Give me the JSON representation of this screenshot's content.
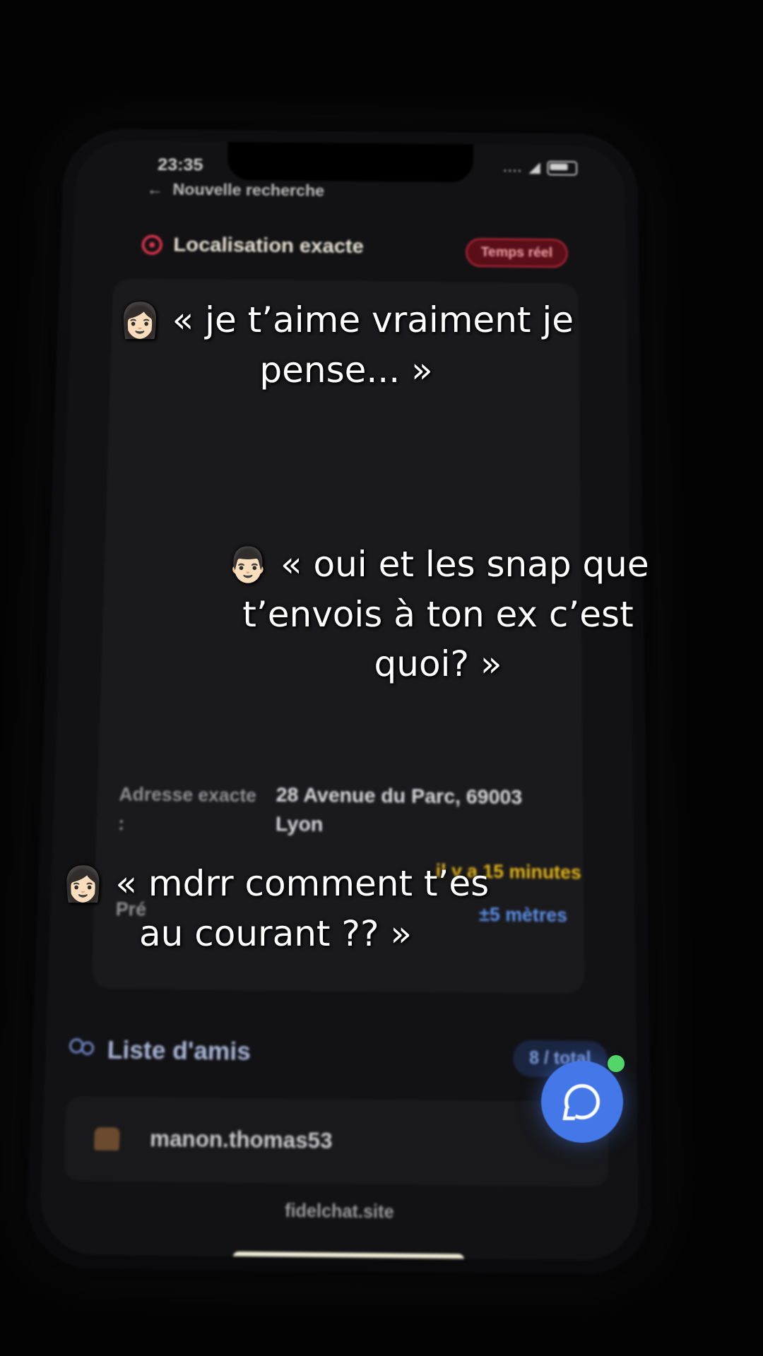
{
  "status_bar": {
    "time": "23:35",
    "signal": "....",
    "wifi_icon": "wifi-icon"
  },
  "nav": {
    "back_arrow": "←",
    "back_label": "Nouvelle recherche"
  },
  "location_section": {
    "title": "Localisation exacte",
    "badge": "Temps réel",
    "address_label": "Adresse exacte",
    "address_label_cont": ":",
    "address_value": "28 Avenue du Parc, 69003",
    "address_value_cont": "Lyon",
    "time_value": "il y a 15 minutes",
    "precision_label": "Pré",
    "precision_value": "±5 mètres"
  },
  "friends": {
    "title": "Liste d'amis",
    "count_badge": "8 / total",
    "items": [
      {
        "username": "manon.thomas53"
      }
    ]
  },
  "footer": {
    "domain": "fidelchat.site"
  },
  "captions": [
    {
      "emoji": "👩🏻",
      "line1": "« je t’aime vraiment je",
      "line2": "pense... »"
    },
    {
      "emoji": "👨🏻",
      "line1": "« oui et les snap que",
      "line2": "t’envois à ton ex c’est",
      "line3": "quoi? »"
    },
    {
      "emoji": "👩🏻",
      "line1": "« mdrr comment t’es",
      "line2": "au courant ?? »"
    }
  ],
  "colors": {
    "accent_red": "#e0314b",
    "accent_blue": "#4478e8",
    "accent_yellow": "#e3b318",
    "online_green": "#52d66a"
  }
}
